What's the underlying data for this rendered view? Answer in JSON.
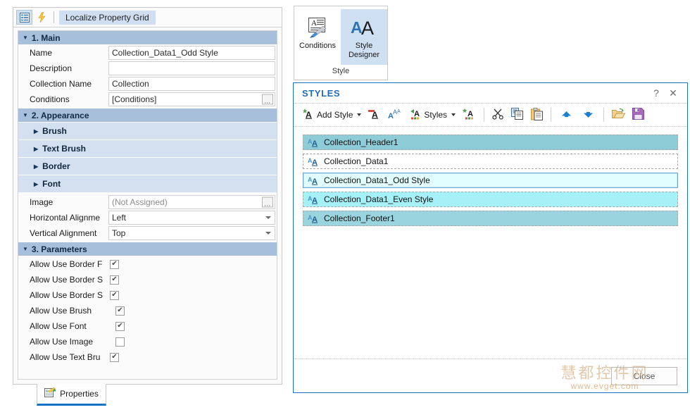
{
  "properties_panel": {
    "toolbar": {
      "categorized_icon": "categorized-view-icon",
      "events_icon": "events-lightning-icon",
      "localize_label": "Localize Property Grid"
    },
    "categories": [
      {
        "title": "1. Main",
        "rows": [
          {
            "label": "Name",
            "value": "Collection_Data1_Odd Style",
            "type": "text"
          },
          {
            "label": "Description",
            "value": "",
            "type": "text"
          },
          {
            "label": "Collection Name",
            "value": "Collection",
            "type": "text"
          },
          {
            "label": "Conditions",
            "value": "[Conditions]",
            "type": "ellipsis"
          }
        ]
      },
      {
        "title": "2. Appearance",
        "subgroups": [
          {
            "label": "Brush"
          },
          {
            "label": "Text Brush"
          },
          {
            "label": "Border"
          },
          {
            "label": "Font"
          }
        ],
        "rows": [
          {
            "label": "Image",
            "value": "(Not Assigned)",
            "type": "ellipsis"
          },
          {
            "label": "Horizontal Alignme",
            "value": "Left",
            "type": "dropdown"
          },
          {
            "label": "Vertical Alignment",
            "value": "Top",
            "type": "dropdown"
          }
        ]
      },
      {
        "title": "3. Parameters",
        "rows": [
          {
            "label": "Allow Use Border F",
            "value": "",
            "type": "checkbox",
            "checked": true
          },
          {
            "label": "Allow Use Border S",
            "value": "",
            "type": "checkbox",
            "checked": true
          },
          {
            "label": "Allow Use Border S",
            "value": "",
            "type": "checkbox",
            "checked": true
          },
          {
            "label": "Allow Use Brush",
            "value": "",
            "type": "checkbox",
            "checked": true
          },
          {
            "label": "Allow Use Font",
            "value": "",
            "type": "checkbox",
            "checked": true
          },
          {
            "label": "Allow Use Image",
            "value": "",
            "type": "checkbox",
            "checked": false
          },
          {
            "label": "Allow Use Text Bru",
            "value": "",
            "type": "checkbox",
            "checked": true
          }
        ]
      }
    ],
    "tab": {
      "label": "Properties",
      "icon": "properties-document-icon"
    }
  },
  "ribbon": {
    "group_caption": "Style",
    "buttons": [
      {
        "label": "Conditions",
        "icon": "conditions-icon",
        "active": false
      },
      {
        "label": "Style\nDesigner",
        "label_line1": "Style",
        "label_line2": "Designer",
        "icon": "style-designer-icon",
        "active": true
      }
    ]
  },
  "styles_dialog": {
    "title": "STYLES",
    "help_label": "?",
    "close_label": "✕",
    "toolbar": [
      {
        "name": "add-style",
        "label": "Add Style",
        "has_caret": true
      },
      {
        "name": "edit-style",
        "label": "",
        "has_caret": false
      },
      {
        "name": "duplicate-style",
        "label": "",
        "has_caret": false
      },
      {
        "name": "styles-menu",
        "label": "Styles",
        "has_caret": true
      },
      {
        "name": "new-style-collection",
        "label": "",
        "has_caret": false
      },
      {
        "name": "cut",
        "label": "",
        "has_caret": false
      },
      {
        "name": "copy",
        "label": "",
        "has_caret": false
      },
      {
        "name": "paste",
        "label": "",
        "has_caret": false
      },
      {
        "name": "move-up",
        "label": "",
        "has_caret": false
      },
      {
        "name": "move-down",
        "label": "",
        "has_caret": false
      },
      {
        "name": "open",
        "label": "",
        "has_caret": false
      },
      {
        "name": "save",
        "label": "",
        "has_caret": false
      }
    ],
    "style_items": [
      {
        "label": "Collection_Header1",
        "bg": "#8ecdd8",
        "selected": false
      },
      {
        "label": "Collection_Data1",
        "bg": "#ffffff",
        "selected": false
      },
      {
        "label": "Collection_Data1_Odd Style",
        "bg": "#e2feff",
        "selected": true
      },
      {
        "label": "Collection_Data1_Even Style",
        "bg": "#a6f0f7",
        "selected": false
      },
      {
        "label": "Collection_Footer1",
        "bg": "#9ad4de",
        "selected": false
      }
    ],
    "close_button": "Close",
    "watermark_cn": "慧都控件网",
    "watermark_url": "www.evget.com"
  },
  "colors": {
    "category_header": "#a8bfdc",
    "subgroup_header": "#d3e0f0",
    "dialog_accent": "#1574c4",
    "selection": "#cfe0f2"
  }
}
